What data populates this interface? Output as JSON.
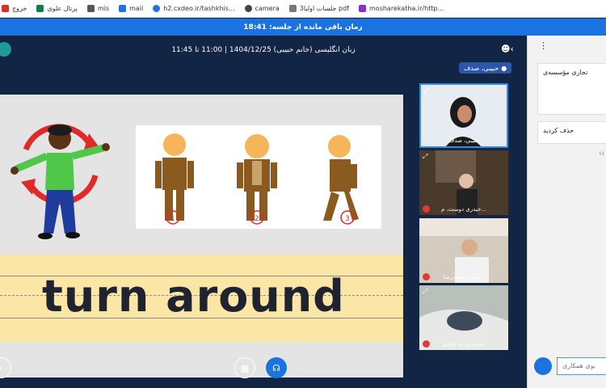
{
  "bookmarks": [
    {
      "label": "خروج",
      "color": "#d93025"
    },
    {
      "label": "پرتال علوی",
      "color": "#0b8043"
    },
    {
      "label": "mis",
      "color": "#555555"
    },
    {
      "label": "mail",
      "color": "#1a73e8"
    },
    {
      "label": "h2.cxdeo.ir/tashkhis...",
      "color": "#1a73e8"
    },
    {
      "label": "camera",
      "color": "#444444"
    },
    {
      "label": "جلسات اولیا3 pdf",
      "color": "#777777"
    },
    {
      "label": "mosharekatha.ir/http...",
      "color": "#8b2fc9"
    }
  ],
  "timer": {
    "text": "زمان باقی مانده از جلسه: 18:41"
  },
  "header": {
    "title": "زبان انگلیسی (خانم حبیبی) 1404/12/25 | 11:00 تا 11:45"
  },
  "speaker": {
    "name": "حبیبی، صدف"
  },
  "slide": {
    "word": "turn around",
    "steps": [
      "1",
      "2",
      "3"
    ]
  },
  "videos": [
    {
      "name": "حبیبی، صدف"
    },
    {
      "name": "حیدری دوست، م..."
    },
    {
      "name": "عیسی، محمدرضا"
    },
    {
      "name": "محمودی نیا، قاسم"
    }
  ],
  "panel": {
    "card1": "تجاری مؤسسه‌ی",
    "card2": "حذف کردید",
    "card3": "۱۱",
    "input_placeholder": "بوی همکاری"
  },
  "colors": {
    "accent": "#1b73e0",
    "background": "#122544",
    "slide_band": "#fbe6a6"
  }
}
